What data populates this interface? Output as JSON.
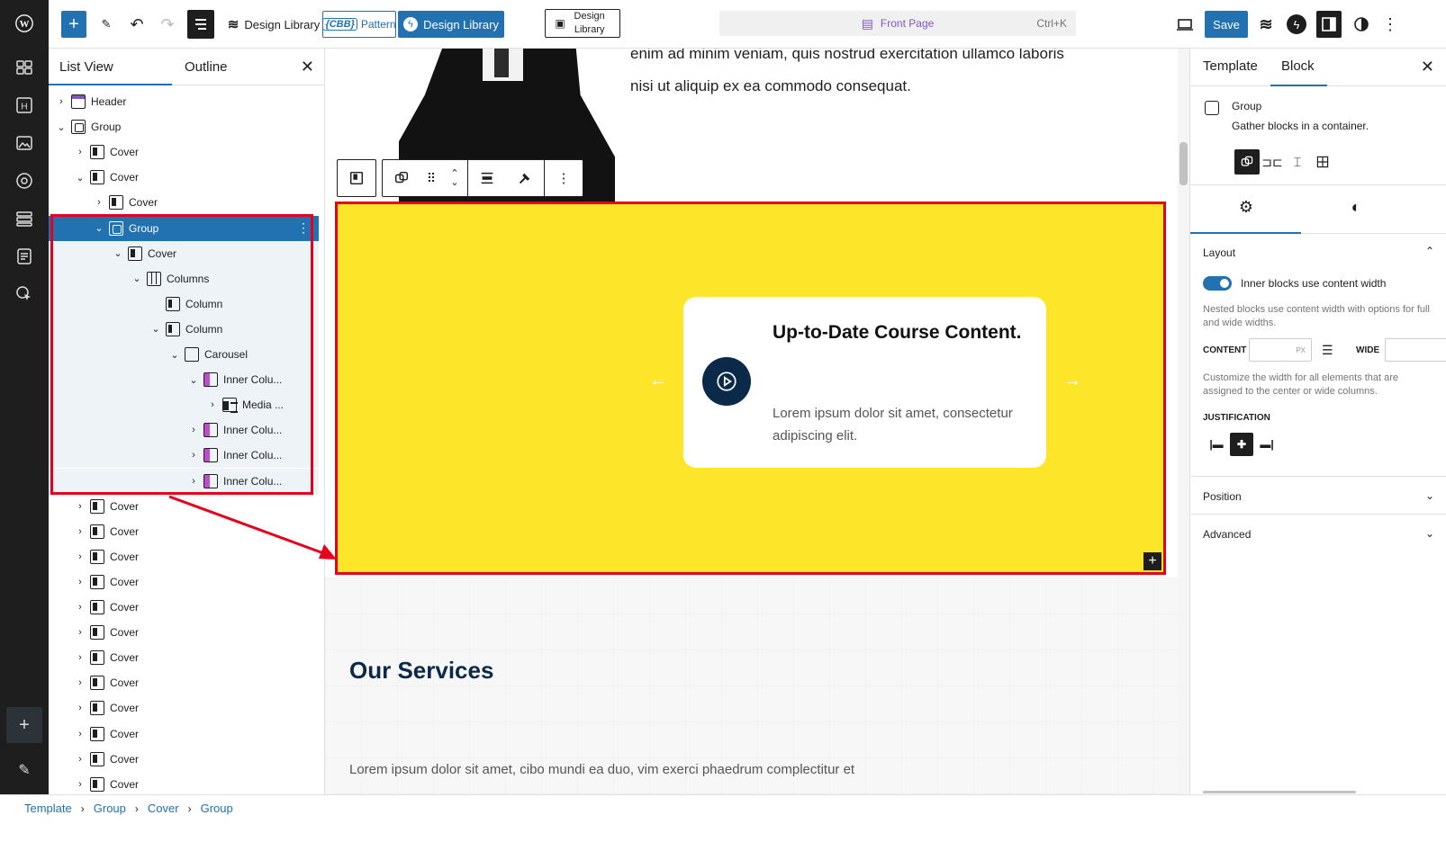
{
  "topbar": {
    "design_library_1": "Design Library",
    "cbb_badge": "{CBB}",
    "cbb_label": "Pattern",
    "design_library_2": "Design Library",
    "design_library_3": "Design Library",
    "command_bar_title": "Front Page",
    "command_bar_shortcut": "Ctrl+K",
    "save_label": "Save"
  },
  "list_panel": {
    "tab_list_view": "List View",
    "tab_outline": "Outline",
    "rows": [
      {
        "label": "Header",
        "icon": "header-icon",
        "depth": 0,
        "chevron": "›"
      },
      {
        "label": "Group",
        "icon": "group-icon",
        "depth": 0,
        "chevron": "⌄"
      },
      {
        "label": "Cover",
        "icon": "cover-icon",
        "depth": 1,
        "chevron": "›"
      },
      {
        "label": "Cover",
        "icon": "cover-icon",
        "depth": 1,
        "chevron": "⌄"
      },
      {
        "label": "Cover",
        "icon": "cover-icon",
        "depth": 2,
        "chevron": "›"
      },
      {
        "label": "Group",
        "icon": "group-icon",
        "depth": 2,
        "chevron": "⌄",
        "selected": true
      },
      {
        "label": "Cover",
        "icon": "cover-icon",
        "depth": 3,
        "chevron": "⌄"
      },
      {
        "label": "Columns",
        "icon": "columns-icon",
        "depth": 4,
        "chevron": "⌄"
      },
      {
        "label": "Column",
        "icon": "column-icon",
        "depth": 5,
        "chevron": ""
      },
      {
        "label": "Column",
        "icon": "column-icon",
        "depth": 5,
        "chevron": "⌄"
      },
      {
        "label": "Carousel",
        "icon": "carousel-icon",
        "depth": 6,
        "chevron": "⌄"
      },
      {
        "label": "Inner Colu...",
        "icon": "inner-column-icon",
        "depth": 7,
        "chevron": "⌄"
      },
      {
        "label": "Media ...",
        "icon": "media-text-icon",
        "depth": 8,
        "chevron": "›"
      },
      {
        "label": "Inner Colu...",
        "icon": "inner-column-icon",
        "depth": 7,
        "chevron": "›"
      },
      {
        "label": "Inner Colu...",
        "icon": "inner-column-icon",
        "depth": 7,
        "chevron": "›"
      },
      {
        "label": "Inner Colu...",
        "icon": "inner-column-icon",
        "depth": 7,
        "chevron": "›"
      },
      {
        "label": "Cover",
        "icon": "cover-icon",
        "depth": 1,
        "chevron": "›"
      },
      {
        "label": "Cover",
        "icon": "cover-icon",
        "depth": 1,
        "chevron": "›"
      },
      {
        "label": "Cover",
        "icon": "cover-icon",
        "depth": 1,
        "chevron": "›"
      },
      {
        "label": "Cover",
        "icon": "cover-icon",
        "depth": 1,
        "chevron": "›"
      },
      {
        "label": "Cover",
        "icon": "cover-icon",
        "depth": 1,
        "chevron": "›"
      },
      {
        "label": "Cover",
        "icon": "cover-icon",
        "depth": 1,
        "chevron": "›"
      },
      {
        "label": "Cover",
        "icon": "cover-icon",
        "depth": 1,
        "chevron": "›"
      },
      {
        "label": "Cover",
        "icon": "cover-icon",
        "depth": 1,
        "chevron": "›"
      },
      {
        "label": "Cover",
        "icon": "cover-icon",
        "depth": 1,
        "chevron": "›"
      },
      {
        "label": "Cover",
        "icon": "cover-icon",
        "depth": 1,
        "chevron": "›"
      },
      {
        "label": "Cover",
        "icon": "cover-icon",
        "depth": 1,
        "chevron": "›"
      },
      {
        "label": "Cover",
        "icon": "cover-icon",
        "depth": 1,
        "chevron": "›"
      }
    ]
  },
  "canvas": {
    "hero_text_line1": "enim ad minim veniam, quis nostrud exercitation ullamco laboris",
    "hero_text_line2": "nisi ut aliquip ex ea commodo consequat.",
    "card_title": "Up-to-Date Course Content.",
    "card_desc": "Lorem ipsum dolor sit amet, consectetur adipiscing elit.",
    "services_title": "Our Services",
    "services_text": "Lorem ipsum dolor sit amet, cibo mundi ea duo, vim exerci phaedrum complectitur et"
  },
  "inspector": {
    "tab_template": "Template",
    "tab_block": "Block",
    "block_name": "Group",
    "block_desc": "Gather blocks in a container.",
    "layout_title": "Layout",
    "toggle_label": "Inner blocks use content width",
    "toggle_help": "Nested blocks use content width with options for full and wide widths.",
    "content_label": "CONTENT",
    "content_unit": "PX",
    "wide_label": "WIDE",
    "customize_help": "Customize the width for all elements that are assigned to the center or wide columns.",
    "justification_label": "JUSTIFICATION",
    "position_title": "Position",
    "advanced_title": "Advanced"
  },
  "breadcrumb": [
    "Template",
    "Group",
    "Cover",
    "Group"
  ],
  "colors": {
    "accent": "#2271b1",
    "highlight": "#e5001b",
    "yellow": "#fde52a",
    "navy": "#0b2a4a"
  }
}
